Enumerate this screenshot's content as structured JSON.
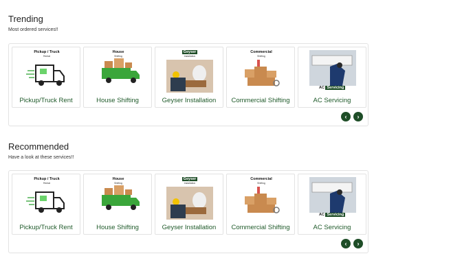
{
  "trending": {
    "title": "Trending",
    "subtitle": "Most ordered services!!",
    "cards": [
      {
        "label": "Pickup/Truck Rent",
        "caption_line1": "Pickup / Truck",
        "caption_line2": "Rental",
        "icon": "pickup-truck-icon"
      },
      {
        "label": "House Shifting",
        "caption_line1": "House",
        "caption_line2": "Shifting",
        "icon": "moving-truck-icon"
      },
      {
        "label": "Geyser Installation",
        "caption_line1": "Geyser",
        "caption_line2": "Installation",
        "icon": "geyser-technician-icon"
      },
      {
        "label": "Commercial Shifting",
        "caption_line1": "Commercial",
        "caption_line2": "Shifting",
        "icon": "boxes-icon"
      },
      {
        "label": "AC Servicing",
        "caption_line1": "AC",
        "caption_line2": "Servicing",
        "icon": "ac-technician-icon"
      }
    ]
  },
  "recommended": {
    "title": "Recommended",
    "subtitle": "Have a look at these services!!",
    "cards": [
      {
        "label": "Pickup/Truck Rent",
        "caption_line1": "Pickup / Truck",
        "caption_line2": "Rental",
        "icon": "pickup-truck-icon"
      },
      {
        "label": "House Shifting",
        "caption_line1": "House",
        "caption_line2": "Shifting",
        "icon": "moving-truck-icon"
      },
      {
        "label": "Geyser Installation",
        "caption_line1": "Geyser",
        "caption_line2": "Installation",
        "icon": "geyser-technician-icon"
      },
      {
        "label": "Commercial Shifting",
        "caption_line1": "Commercial",
        "caption_line2": "Shifting",
        "icon": "boxes-icon"
      },
      {
        "label": "AC Servicing",
        "caption_line1": "AC",
        "caption_line2": "Servicing",
        "icon": "ac-technician-icon"
      }
    ]
  },
  "nav": {
    "prev": "‹",
    "next": "›"
  },
  "colors": {
    "accent": "#1e4d27",
    "label": "#1f5a2a",
    "truck_green": "#3aa63a",
    "box_brown": "#c98a4f"
  }
}
